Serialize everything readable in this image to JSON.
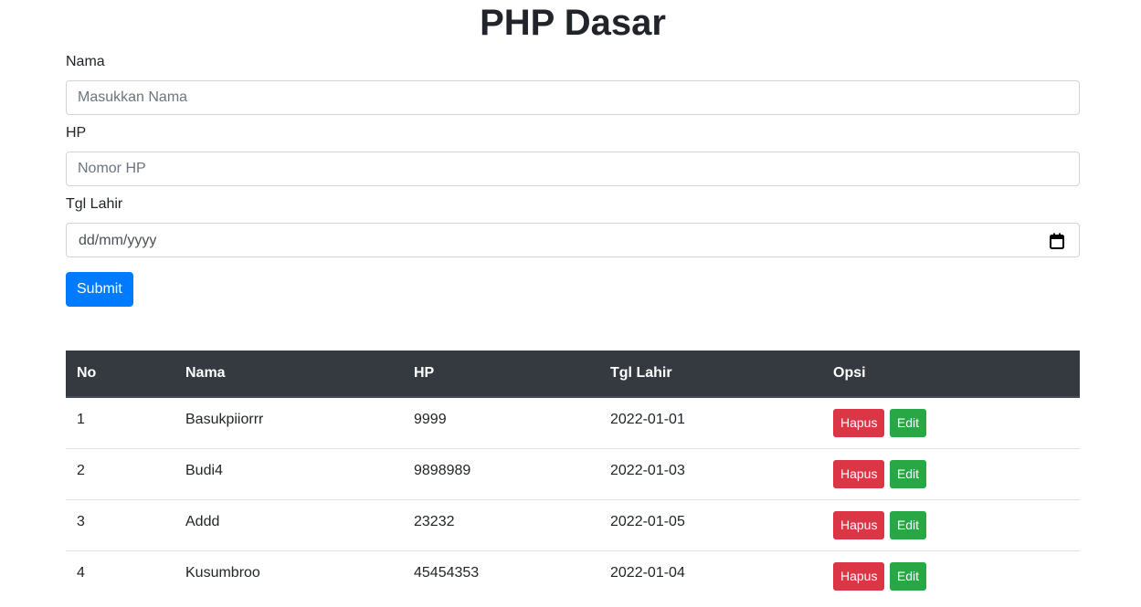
{
  "page": {
    "title": "PHP Dasar"
  },
  "form": {
    "nama": {
      "label": "Nama",
      "placeholder": "Masukkan Nama",
      "value": ""
    },
    "hp": {
      "label": "HP",
      "placeholder": "Nomor HP",
      "value": ""
    },
    "tgl_lahir": {
      "label": "Tgl Lahir",
      "display_value": "dd/mm/yyyy",
      "icon": "calendar-icon"
    },
    "submit_label": "Submit"
  },
  "table": {
    "headers": [
      "No",
      "Nama",
      "HP",
      "Tgl Lahir",
      "Opsi"
    ],
    "rows": [
      {
        "no": "1",
        "nama": "Basukpiiorrr",
        "hp": "9999",
        "tgl_lahir": "2022-01-01",
        "hapus": "Hapus",
        "edit": "Edit"
      },
      {
        "no": "2",
        "nama": "Budi4",
        "hp": "9898989",
        "tgl_lahir": "2022-01-03",
        "hapus": "Hapus",
        "edit": "Edit"
      },
      {
        "no": "3",
        "nama": "Addd",
        "hp": "23232",
        "tgl_lahir": "2022-01-05",
        "hapus": "Hapus",
        "edit": "Edit"
      },
      {
        "no": "4",
        "nama": "Kusumbroo",
        "hp": "45454353",
        "tgl_lahir": "2022-01-04",
        "hapus": "Hapus",
        "edit": "Edit"
      }
    ]
  },
  "colors": {
    "primary": "#007bff",
    "danger": "#dc3545",
    "success": "#28a745",
    "table_header": "#343a40"
  }
}
